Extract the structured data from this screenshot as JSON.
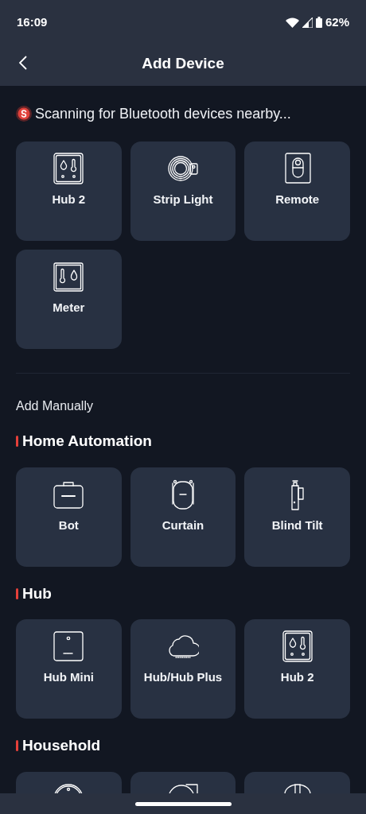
{
  "status_bar": {
    "time": "16:09",
    "battery": "62%"
  },
  "header": {
    "title": "Add Device"
  },
  "scanning": {
    "text": "Scanning for Bluetooth devices nearby..."
  },
  "nearby_devices": [
    {
      "label": "Hub 2",
      "kind": "hub2"
    },
    {
      "label": "Strip Light",
      "kind": "strip"
    },
    {
      "label": "Remote",
      "kind": "remote"
    },
    {
      "label": "Meter",
      "kind": "meter"
    }
  ],
  "manual": {
    "title": "Add Manually"
  },
  "sections": [
    {
      "title": "Home Automation",
      "devices": [
        {
          "label": "Bot",
          "kind": "bot"
        },
        {
          "label": "Curtain",
          "kind": "curtain"
        },
        {
          "label": "Blind Tilt",
          "kind": "blind"
        }
      ]
    },
    {
      "title": "Hub",
      "devices": [
        {
          "label": "Hub Mini",
          "kind": "hubmini"
        },
        {
          "label": "Hub/Hub Plus",
          "kind": "cloud"
        },
        {
          "label": "Hub 2",
          "kind": "hub2"
        }
      ]
    },
    {
      "title": "Household",
      "devices": [
        {
          "kind": "round"
        },
        {
          "kind": "roundframe"
        },
        {
          "kind": "dome"
        }
      ]
    }
  ]
}
